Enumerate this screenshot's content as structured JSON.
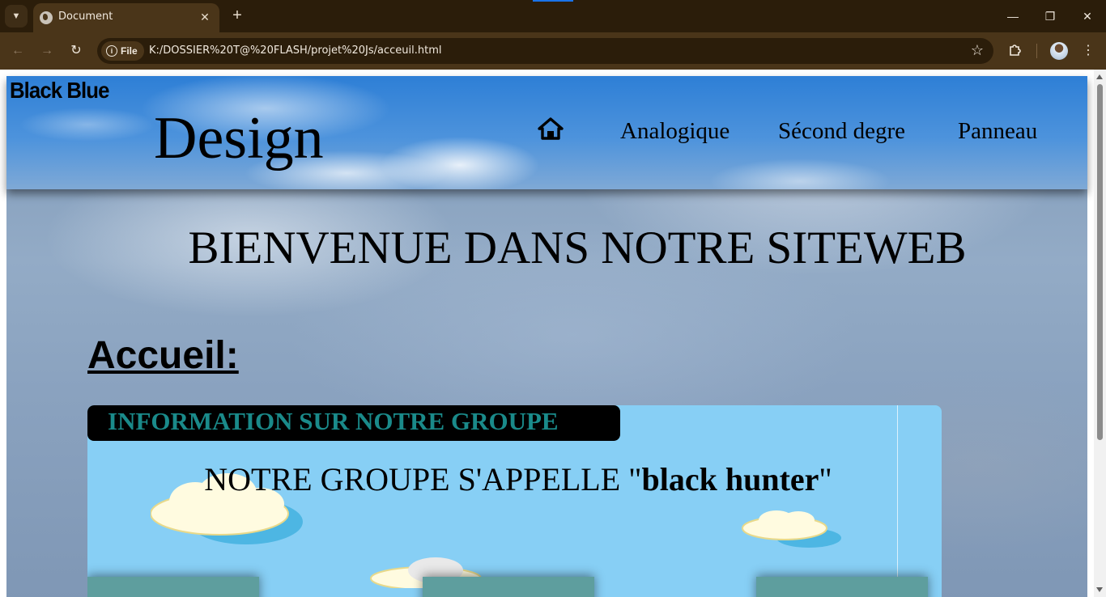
{
  "browser": {
    "tab_title": "Document",
    "site_chip_label": "File",
    "url": "K:/DOSSIER%20T@%20FLASH/projet%20Js/acceuil.html",
    "icons": {
      "tab_menu": "chevron-down-icon",
      "favicon": "globe-icon",
      "close": "close-icon",
      "new_tab": "plus-icon",
      "back": "arrow-left-icon",
      "forward": "arrow-right-icon",
      "reload": "reload-icon",
      "bookmark": "star-icon",
      "extensions": "puzzle-icon",
      "menu": "kebab-menu-icon"
    }
  },
  "header": {
    "brand_small": "Black Blue",
    "brand_big": "Design",
    "nav": [
      "Analogique",
      "Sécond degre",
      "Panneau"
    ]
  },
  "main": {
    "welcome": "BIENVENUE DANS NOTRE SITEWEB",
    "heading": "Accueil:",
    "card": {
      "title": "INFORMATION SUR NOTRE GROUPE",
      "group_prefix": "NOTRE GROUPE S'APPELLE \"",
      "group_name": "black hunter",
      "group_suffix": "\""
    }
  },
  "colors": {
    "tab_bar": "#2b1d0a",
    "toolbar": "#4a3519",
    "card_bg": "#87cff5",
    "card_title": "#1a8a8a",
    "box_bg": "#5e9e9e"
  }
}
